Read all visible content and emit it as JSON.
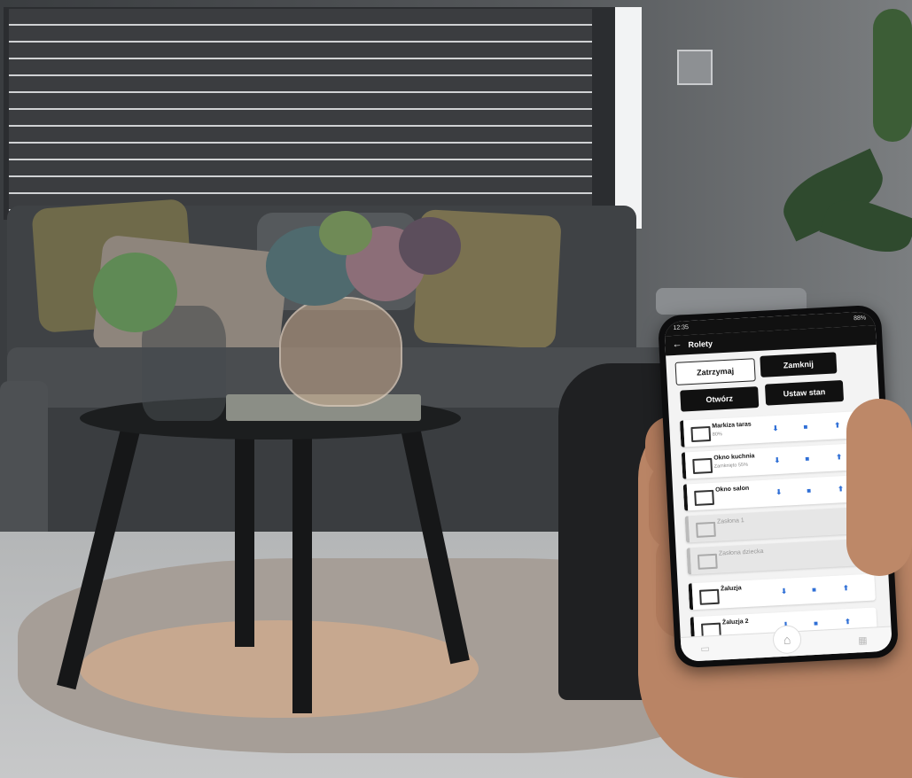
{
  "status_bar": {
    "time": "12:35",
    "battery": "88%"
  },
  "header": {
    "title": "Rolety",
    "back_icon": "arrow-left-icon"
  },
  "actions": [
    {
      "label": "Zatrzymaj",
      "style": "light"
    },
    {
      "label": "Zamknij",
      "style": "dark"
    },
    {
      "label": "Otwórz",
      "style": "dark"
    },
    {
      "label": "Ustaw stan",
      "style": "dark"
    }
  ],
  "devices": [
    {
      "name": "Markiza taras",
      "subtitle": "80%",
      "icon": "awning-icon",
      "controls": [
        "down-arrow-icon",
        "stop-icon",
        "up-arrow-icon"
      ],
      "active": true
    },
    {
      "name": "Okno kuchnia",
      "subtitle": "Zamknięto 55%",
      "icon": "window-icon",
      "controls": [
        "down-arrow-icon",
        "stop-icon",
        "up-arrow-icon"
      ],
      "active": true
    },
    {
      "name": "Okno salon",
      "subtitle": "",
      "icon": "window-icon",
      "controls": [
        "down-arrow-icon",
        "stop-icon",
        "up-arrow-icon"
      ],
      "active": true
    },
    {
      "name": "Zasłona 1",
      "subtitle": "",
      "icon": "curtain-icon",
      "controls": [],
      "active": false
    },
    {
      "name": "Zasłona dziecka",
      "subtitle": "",
      "icon": "curtain-icon",
      "controls": [],
      "active": false
    },
    {
      "name": "Żaluzja",
      "subtitle": "",
      "icon": "blind-icon",
      "controls": [
        "down-arrow-icon",
        "stop-icon",
        "up-arrow-icon"
      ],
      "active": true
    },
    {
      "name": "Żaluzja 2",
      "subtitle": "",
      "icon": "blind-icon",
      "controls": [
        "down-arrow-icon",
        "stop-icon",
        "up-arrow-icon"
      ],
      "active": true
    }
  ],
  "glyphs": {
    "down": "⬇",
    "stop": "■",
    "up": "⬆",
    "more": "⋮",
    "back": "←",
    "home": "⌂",
    "nav_left": "▭",
    "nav_right": "▦"
  },
  "colors": {
    "accent": "#2f6fd6",
    "dark": "#111111"
  }
}
